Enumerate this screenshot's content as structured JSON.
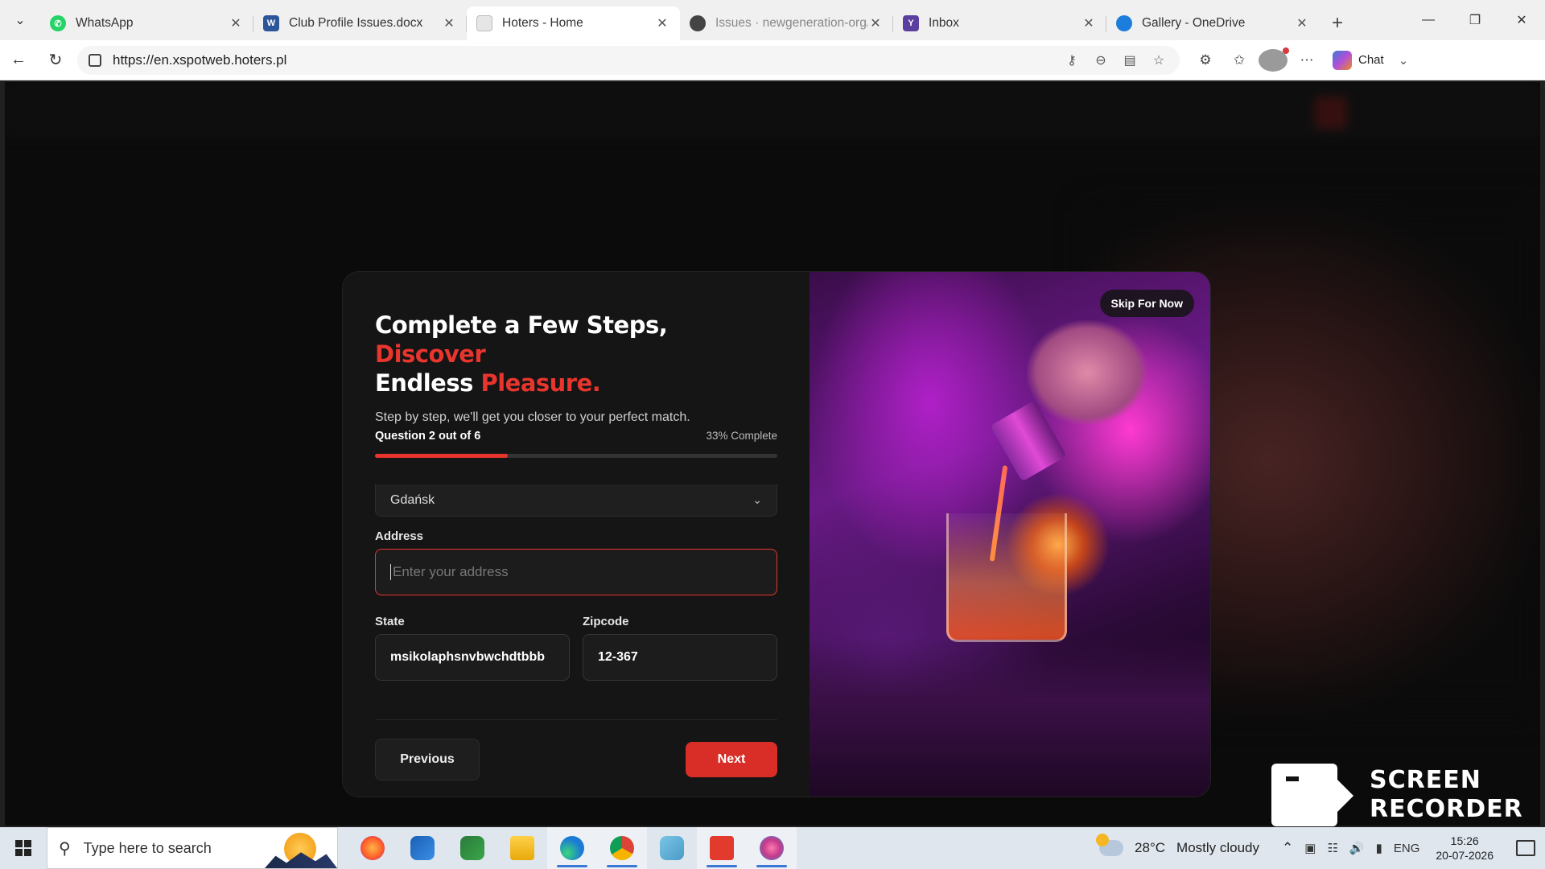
{
  "browser": {
    "tabs": [
      {
        "title": "WhatsApp",
        "favicon": "whatsapp-icon",
        "color": "#25d366",
        "active": false
      },
      {
        "title": "Club Profile Issues.docx",
        "favicon": "word-icon",
        "color": "#2b579a",
        "active": false
      },
      {
        "title": "Hoters - Home",
        "favicon": "page-icon",
        "color": "#cccccc",
        "active": true
      },
      {
        "title": "Issues · newgeneration-org/h",
        "favicon": "github-icon",
        "color": "#444444",
        "active": false
      },
      {
        "title": "Inbox",
        "favicon": "yahoo-icon",
        "color": "#5b3f9e",
        "active": false
      },
      {
        "title": "Gallery - OneDrive",
        "favicon": "onedrive-icon",
        "color": "#1d7ddc",
        "active": false
      }
    ],
    "url": "https://en.xspotweb.hoters.pl",
    "chat_label": "Chat"
  },
  "modal": {
    "headline_line1_white": "Complete a Few Steps,",
    "headline_line1_red": "Discover",
    "headline_line2_white": "Endless",
    "headline_line2_red": "Pleasure.",
    "subtitle": "Step by step, we'll get you closer to your perfect match.",
    "question_label": "Question 2 out of 6",
    "progress_label": "33% Complete",
    "progress_fraction": 0.33,
    "city_value": "Gdańsk",
    "address_label": "Address",
    "address_placeholder": "Enter your address",
    "state_label": "State",
    "state_value": "msikolaphsnvbwchdtbbb",
    "zipcode_label": "Zipcode",
    "zipcode_value": "12-367",
    "previous_label": "Previous",
    "next_label": "Next",
    "skip_label": "Skip For Now",
    "accent_color": "#e8352d"
  },
  "watermark": {
    "line1": "SCREEN",
    "line2": "RECORDER"
  },
  "taskbar": {
    "search_placeholder": "Type here to search",
    "apps": [
      "firefox-icon",
      "outlook-icon",
      "visual-studio-icon",
      "file-explorer-icon",
      "edge-icon",
      "chrome-icon",
      "notepad-icon",
      "recorder-icon",
      "paint-icon"
    ],
    "weather_temp": "28°C",
    "weather_desc": "Mostly cloudy",
    "language": "ENG",
    "time": "15:26",
    "date": "20-07-2026"
  }
}
